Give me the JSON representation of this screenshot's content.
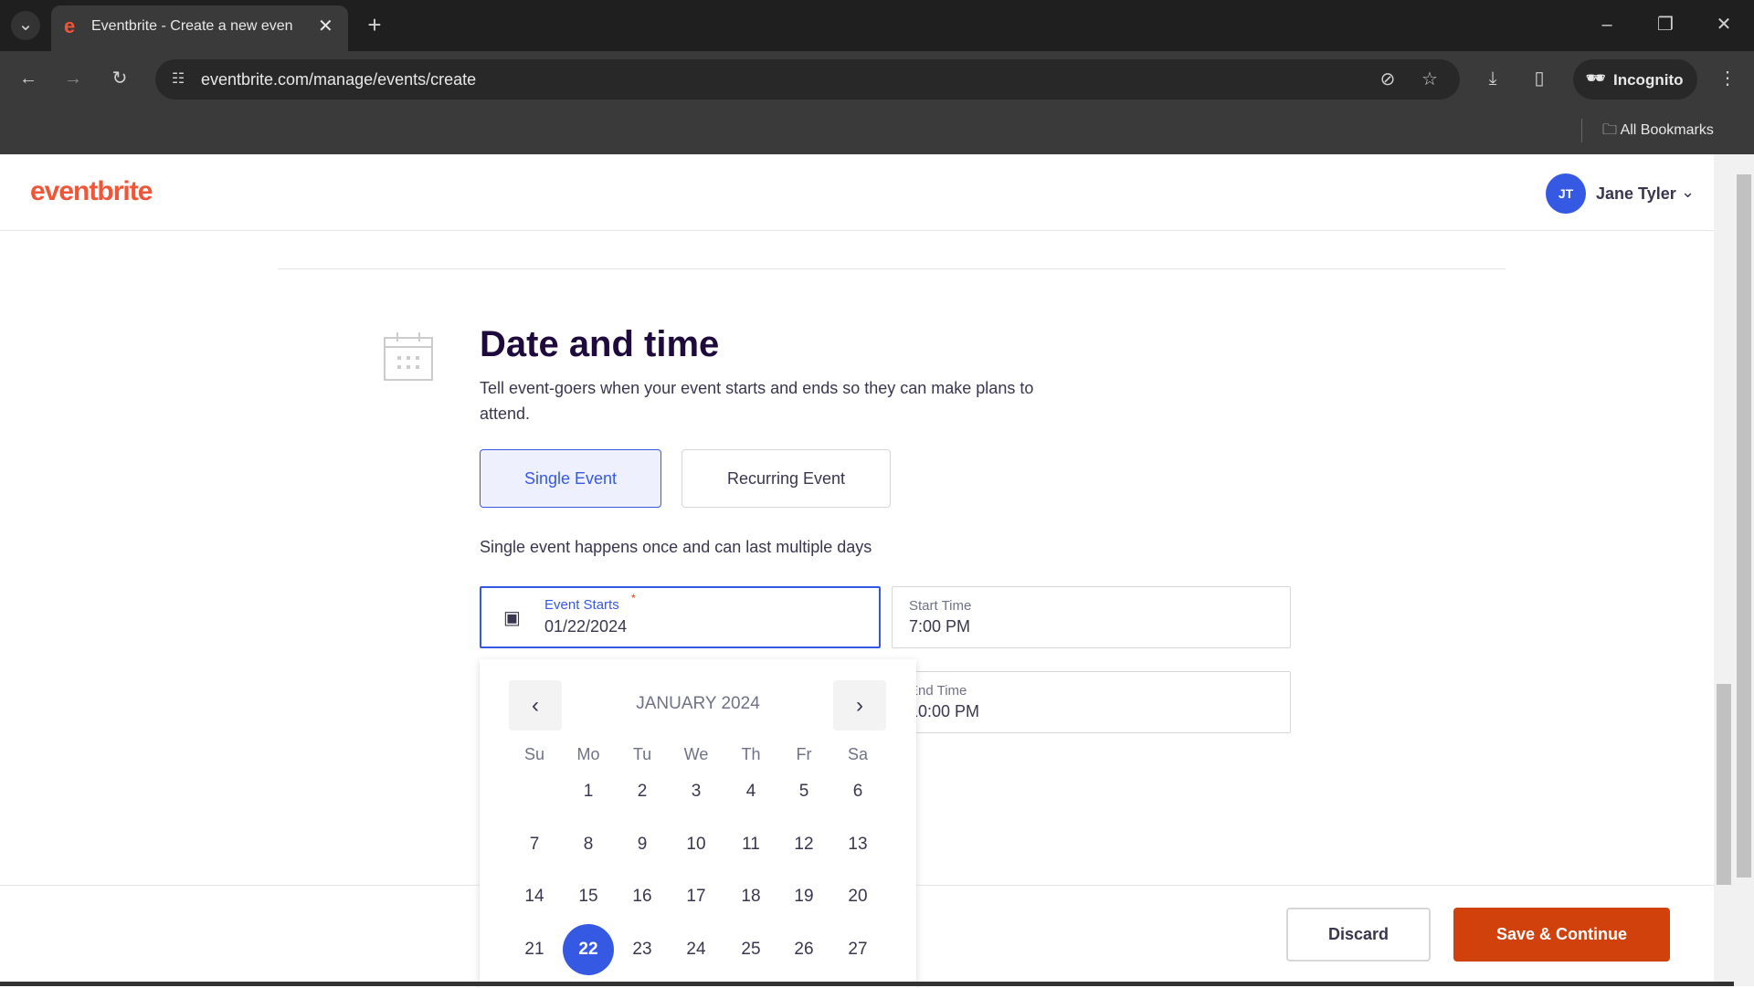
{
  "browser": {
    "tab_title": "Eventbrite - Create a new even",
    "url": "eventbrite.com/manage/events/create",
    "profile_label": "Incognito",
    "bookmarks_label": "All Bookmarks"
  },
  "header": {
    "logo": "eventbrite",
    "user_initials": "JT",
    "user_name": "Jane Tyler"
  },
  "section": {
    "title": "Date and time",
    "description": "Tell event-goers when your event starts and ends so they can make plans to attend.",
    "single_label": "Single Event",
    "recurring_label": "Recurring Event",
    "note": "Single event happens once and can last multiple days"
  },
  "fields": {
    "event_starts_label": "Event Starts",
    "event_starts_value": "01/22/2024",
    "required_mark": "*",
    "start_time_label": "Start Time",
    "start_time_value": "7:00 PM",
    "end_time_label": "End Time",
    "end_time_value": "10:00 PM"
  },
  "calendar": {
    "month_label": "JANUARY 2024",
    "weekdays": [
      "Su",
      "Mo",
      "Tu",
      "We",
      "Th",
      "Fr",
      "Sa"
    ],
    "weeks": [
      [
        "",
        "1",
        "2",
        "3",
        "4",
        "5",
        "6"
      ],
      [
        "7",
        "8",
        "9",
        "10",
        "11",
        "12",
        "13"
      ],
      [
        "14",
        "15",
        "16",
        "17",
        "18",
        "19",
        "20"
      ],
      [
        "21",
        "22",
        "23",
        "24",
        "25",
        "26",
        "27"
      ]
    ],
    "selected": "22"
  },
  "footer": {
    "discard_label": "Discard",
    "save_label": "Save & Continue"
  },
  "colors": {
    "brand": "#f05537",
    "accent": "#3659e3",
    "save": "#d1410c"
  }
}
